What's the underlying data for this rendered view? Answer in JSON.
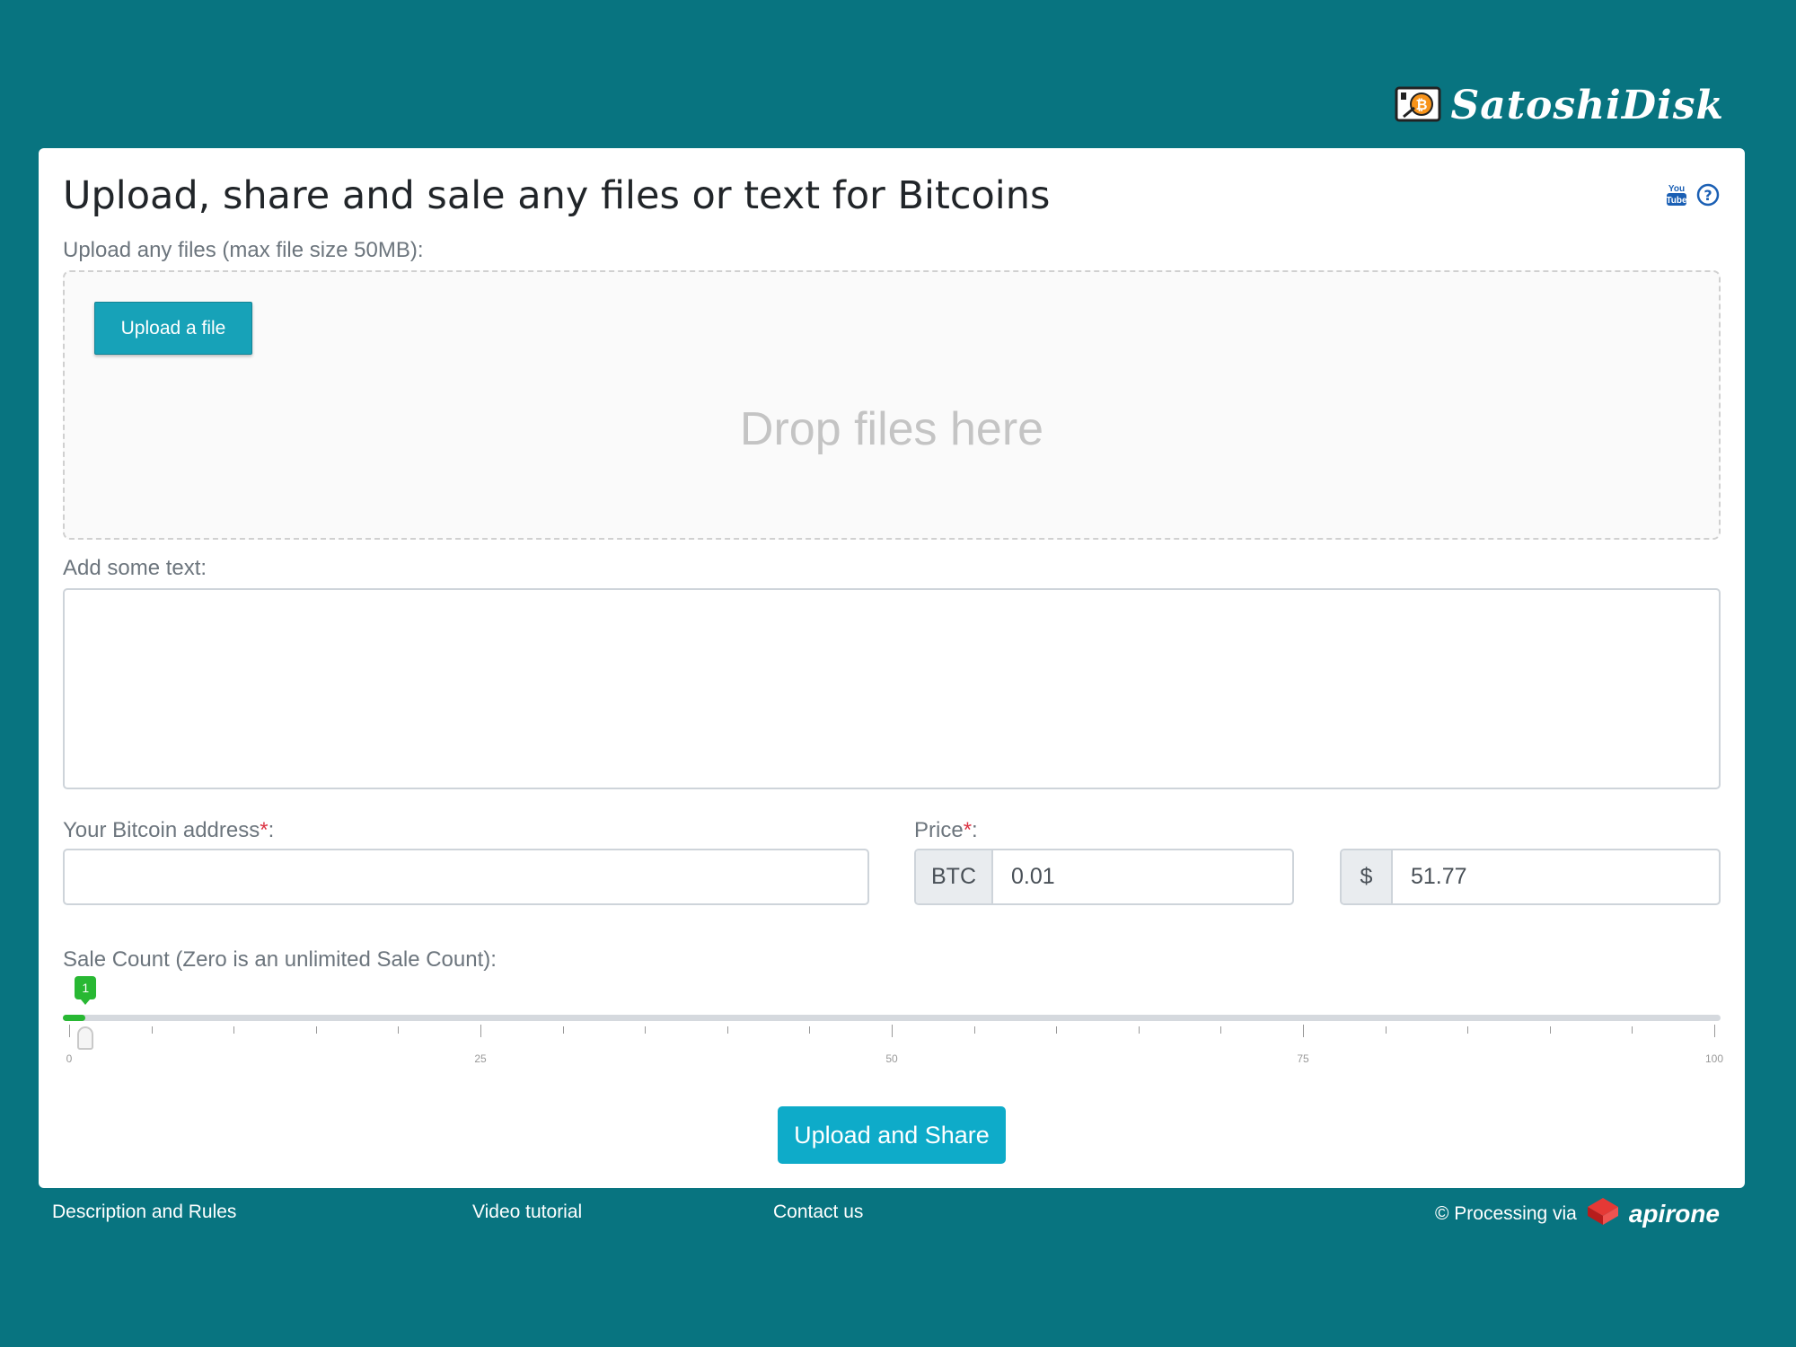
{
  "brand": {
    "name": "SatoshiDisk"
  },
  "page": {
    "title": "Upload, share and sale any files or text for Bitcoins"
  },
  "upload": {
    "label": "Upload any files (max file size 50MB):",
    "button_label": "Upload a file",
    "drop_text": "Drop files here"
  },
  "text": {
    "label": "Add some text:"
  },
  "address": {
    "label": "Your Bitcoin address",
    "value": ""
  },
  "price": {
    "label": "Price",
    "btc_addon": "BTC",
    "btc_value": "0.01",
    "usd_addon": "$",
    "usd_value": "51.77"
  },
  "required_mark": "*",
  "label_suffix": ":",
  "sale_count": {
    "label": "Sale Count (Zero is an unlimited Sale Count):",
    "value": 1,
    "value_label": "1",
    "min": 0,
    "max": 100,
    "tick_labels": [
      "0",
      "25",
      "50",
      "75",
      "100"
    ]
  },
  "submit": {
    "label": "Upload and Share"
  },
  "footer": {
    "description": "Description and Rules",
    "video": "Video tutorial",
    "contact": "Contact us",
    "processing": "© Processing via",
    "processor": "apirone"
  },
  "icons": {
    "logo": "satoshidisk-logo-icon",
    "youtube": "youtube-icon",
    "help": "help-circle-icon",
    "apirone": "apirone-logo-icon"
  },
  "colors": {
    "background": "#087480",
    "accent": "#17a2b8",
    "submit": "#0eabc9",
    "slider": "#28b833",
    "required": "#dc3545"
  }
}
